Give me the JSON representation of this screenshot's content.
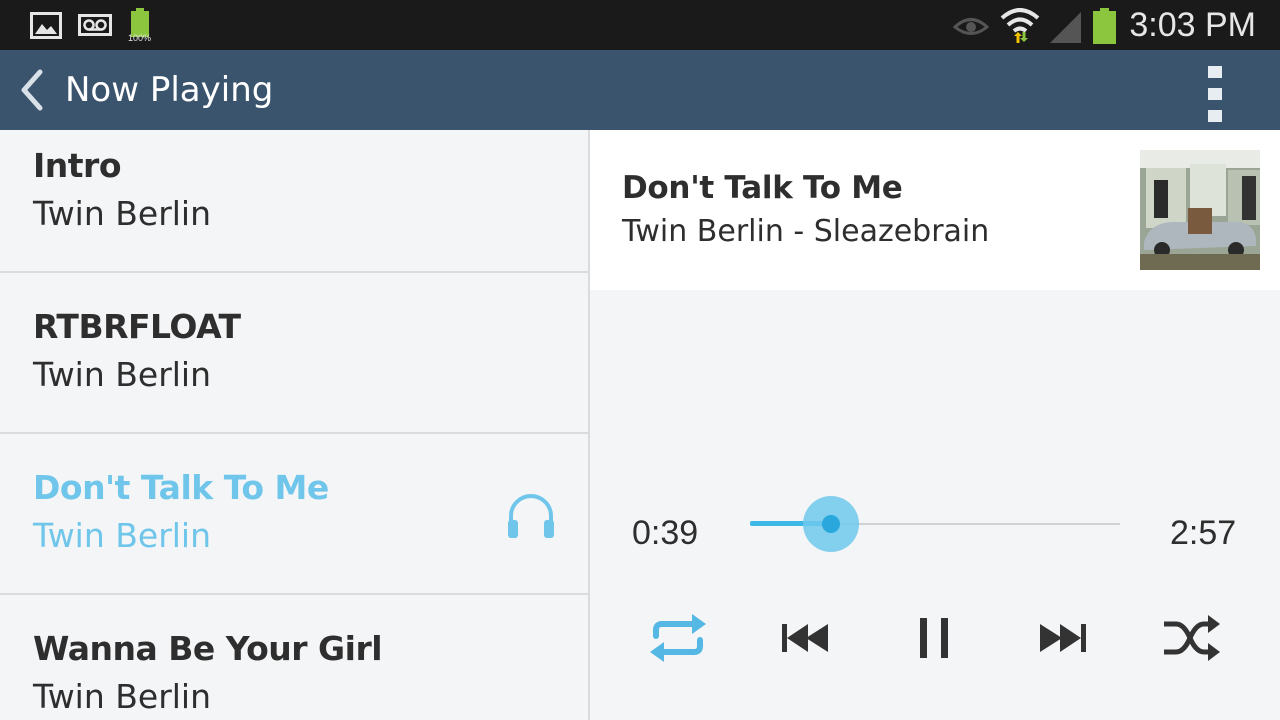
{
  "status_bar": {
    "time": "3:03 PM",
    "battery_percent": "100%",
    "icons": [
      "image-notification-icon",
      "voicemail-icon",
      "battery-charging-icon",
      "eye-icon",
      "wifi-icon",
      "signal-icon",
      "battery-icon"
    ]
  },
  "app_bar": {
    "title": "Now Playing",
    "back_icon": "chevron-left-icon",
    "menu_icon": "overflow-menu-icon"
  },
  "tracks": [
    {
      "title": "Intro",
      "artist": "Twin Berlin",
      "active": false
    },
    {
      "title": "RTBRFLOAT",
      "artist": "Twin Berlin",
      "active": false
    },
    {
      "title": "Don't Talk To Me",
      "artist": "Twin Berlin",
      "active": true
    },
    {
      "title": "Wanna Be Your Girl",
      "artist": "Twin Berlin",
      "active": false
    }
  ],
  "now_playing": {
    "title": "Don't Talk To Me",
    "subtitle": "Twin Berlin - Sleazebrain",
    "current_time": "0:39",
    "total_time": "2:57",
    "progress_fraction": 0.22
  },
  "controls": [
    "repeat-icon",
    "previous-icon",
    "pause-icon",
    "next-icon",
    "shuffle-icon"
  ],
  "colors": {
    "accent": "#3bb8e6",
    "active_text": "#6fc6ea",
    "app_bar": "#3b546d",
    "status_bar": "#1a1a1a"
  }
}
